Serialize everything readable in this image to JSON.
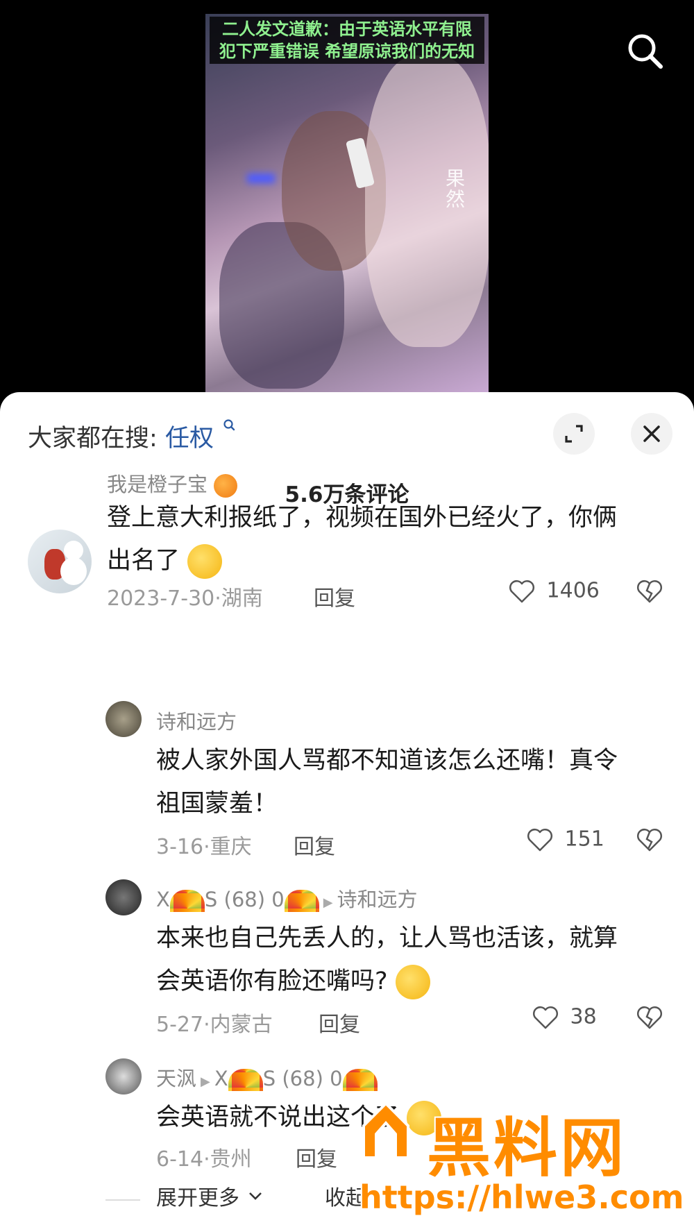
{
  "video": {
    "caption_line1": "二人发文道歉：由于英语水平有限",
    "caption_line2": "犯下严重错误 希望原谅我们的无知",
    "watermark": "果然"
  },
  "header": {
    "search_icon": "search-icon"
  },
  "sheet": {
    "trending_prefix": "大家都在搜:",
    "trending_term": "任权",
    "comment_count": "5.6万条评论",
    "expand_icon": "expand-icon",
    "close_icon": "close-icon"
  },
  "comments": [
    {
      "user": "我是橙子宝",
      "text_line1": "登上意大利报纸了，视频在国外已经火了，你俩",
      "text_line2": "出名了",
      "date_loc": "2023-7-30·湖南",
      "reply": "回复",
      "likes": "1406"
    },
    {
      "user": "诗和远方",
      "text_line1": "被人家外国人骂都不知道该怎么还嘴！真令",
      "text_line2": "祖国蒙羞！",
      "date_loc": "3-16·重庆",
      "reply": "回复",
      "likes": "151"
    },
    {
      "user_a": "X",
      "user_b": "S (68) 0",
      "reply_to": "诗和远方",
      "text_line1": "本来也自己先丢人的，让人骂也活该，就算",
      "text_line2": "会英语你有脸还嘴吗?",
      "date_loc": "5-27·内蒙古",
      "reply": "回复",
      "likes": "38"
    },
    {
      "user": "天沨",
      "reply_to_a": "X",
      "reply_to_b": "S (68) 0",
      "text_line1": "会英语就不说出这个了",
      "date_loc": "6-14·贵州",
      "reply": "回复"
    }
  ],
  "footer": {
    "expand_more": "展开更多",
    "collapse": "收起"
  },
  "site_watermark": {
    "logo_text": "黑料网",
    "url": "https://hlwe3.com"
  },
  "colors": {
    "caption_green": "#8ff08f",
    "trend_blue": "#2a5aa3",
    "watermark_orange": "#ff8c00"
  }
}
